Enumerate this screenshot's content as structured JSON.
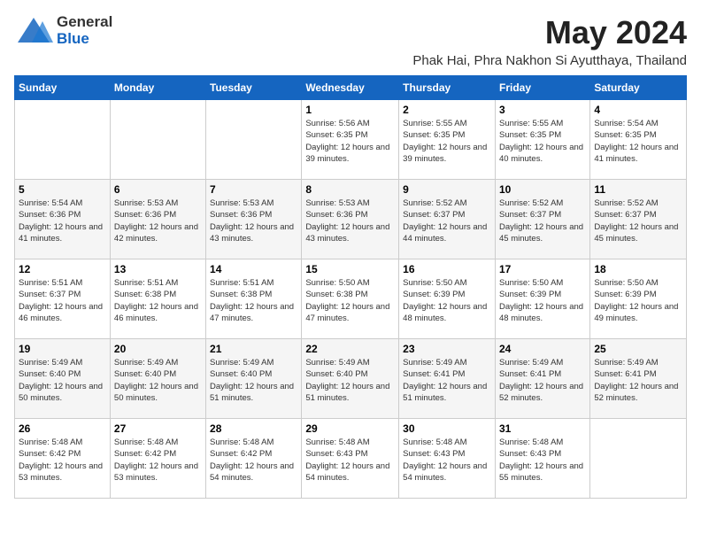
{
  "logo": {
    "general": "General",
    "blue": "Blue"
  },
  "title": {
    "month_year": "May 2024",
    "location": "Phak Hai, Phra Nakhon Si Ayutthaya, Thailand"
  },
  "calendar": {
    "headers": [
      "Sunday",
      "Monday",
      "Tuesday",
      "Wednesday",
      "Thursday",
      "Friday",
      "Saturday"
    ],
    "weeks": [
      [
        {
          "day": "",
          "info": ""
        },
        {
          "day": "",
          "info": ""
        },
        {
          "day": "",
          "info": ""
        },
        {
          "day": "1",
          "info": "Sunrise: 5:56 AM\nSunset: 6:35 PM\nDaylight: 12 hours and 39 minutes."
        },
        {
          "day": "2",
          "info": "Sunrise: 5:55 AM\nSunset: 6:35 PM\nDaylight: 12 hours and 39 minutes."
        },
        {
          "day": "3",
          "info": "Sunrise: 5:55 AM\nSunset: 6:35 PM\nDaylight: 12 hours and 40 minutes."
        },
        {
          "day": "4",
          "info": "Sunrise: 5:54 AM\nSunset: 6:35 PM\nDaylight: 12 hours and 41 minutes."
        }
      ],
      [
        {
          "day": "5",
          "info": "Sunrise: 5:54 AM\nSunset: 6:36 PM\nDaylight: 12 hours and 41 minutes."
        },
        {
          "day": "6",
          "info": "Sunrise: 5:53 AM\nSunset: 6:36 PM\nDaylight: 12 hours and 42 minutes."
        },
        {
          "day": "7",
          "info": "Sunrise: 5:53 AM\nSunset: 6:36 PM\nDaylight: 12 hours and 43 minutes."
        },
        {
          "day": "8",
          "info": "Sunrise: 5:53 AM\nSunset: 6:36 PM\nDaylight: 12 hours and 43 minutes."
        },
        {
          "day": "9",
          "info": "Sunrise: 5:52 AM\nSunset: 6:37 PM\nDaylight: 12 hours and 44 minutes."
        },
        {
          "day": "10",
          "info": "Sunrise: 5:52 AM\nSunset: 6:37 PM\nDaylight: 12 hours and 45 minutes."
        },
        {
          "day": "11",
          "info": "Sunrise: 5:52 AM\nSunset: 6:37 PM\nDaylight: 12 hours and 45 minutes."
        }
      ],
      [
        {
          "day": "12",
          "info": "Sunrise: 5:51 AM\nSunset: 6:37 PM\nDaylight: 12 hours and 46 minutes."
        },
        {
          "day": "13",
          "info": "Sunrise: 5:51 AM\nSunset: 6:38 PM\nDaylight: 12 hours and 46 minutes."
        },
        {
          "day": "14",
          "info": "Sunrise: 5:51 AM\nSunset: 6:38 PM\nDaylight: 12 hours and 47 minutes."
        },
        {
          "day": "15",
          "info": "Sunrise: 5:50 AM\nSunset: 6:38 PM\nDaylight: 12 hours and 47 minutes."
        },
        {
          "day": "16",
          "info": "Sunrise: 5:50 AM\nSunset: 6:39 PM\nDaylight: 12 hours and 48 minutes."
        },
        {
          "day": "17",
          "info": "Sunrise: 5:50 AM\nSunset: 6:39 PM\nDaylight: 12 hours and 48 minutes."
        },
        {
          "day": "18",
          "info": "Sunrise: 5:50 AM\nSunset: 6:39 PM\nDaylight: 12 hours and 49 minutes."
        }
      ],
      [
        {
          "day": "19",
          "info": "Sunrise: 5:49 AM\nSunset: 6:40 PM\nDaylight: 12 hours and 50 minutes."
        },
        {
          "day": "20",
          "info": "Sunrise: 5:49 AM\nSunset: 6:40 PM\nDaylight: 12 hours and 50 minutes."
        },
        {
          "day": "21",
          "info": "Sunrise: 5:49 AM\nSunset: 6:40 PM\nDaylight: 12 hours and 51 minutes."
        },
        {
          "day": "22",
          "info": "Sunrise: 5:49 AM\nSunset: 6:40 PM\nDaylight: 12 hours and 51 minutes."
        },
        {
          "day": "23",
          "info": "Sunrise: 5:49 AM\nSunset: 6:41 PM\nDaylight: 12 hours and 51 minutes."
        },
        {
          "day": "24",
          "info": "Sunrise: 5:49 AM\nSunset: 6:41 PM\nDaylight: 12 hours and 52 minutes."
        },
        {
          "day": "25",
          "info": "Sunrise: 5:49 AM\nSunset: 6:41 PM\nDaylight: 12 hours and 52 minutes."
        }
      ],
      [
        {
          "day": "26",
          "info": "Sunrise: 5:48 AM\nSunset: 6:42 PM\nDaylight: 12 hours and 53 minutes."
        },
        {
          "day": "27",
          "info": "Sunrise: 5:48 AM\nSunset: 6:42 PM\nDaylight: 12 hours and 53 minutes."
        },
        {
          "day": "28",
          "info": "Sunrise: 5:48 AM\nSunset: 6:42 PM\nDaylight: 12 hours and 54 minutes."
        },
        {
          "day": "29",
          "info": "Sunrise: 5:48 AM\nSunset: 6:43 PM\nDaylight: 12 hours and 54 minutes."
        },
        {
          "day": "30",
          "info": "Sunrise: 5:48 AM\nSunset: 6:43 PM\nDaylight: 12 hours and 54 minutes."
        },
        {
          "day": "31",
          "info": "Sunrise: 5:48 AM\nSunset: 6:43 PM\nDaylight: 12 hours and 55 minutes."
        },
        {
          "day": "",
          "info": ""
        }
      ]
    ]
  }
}
